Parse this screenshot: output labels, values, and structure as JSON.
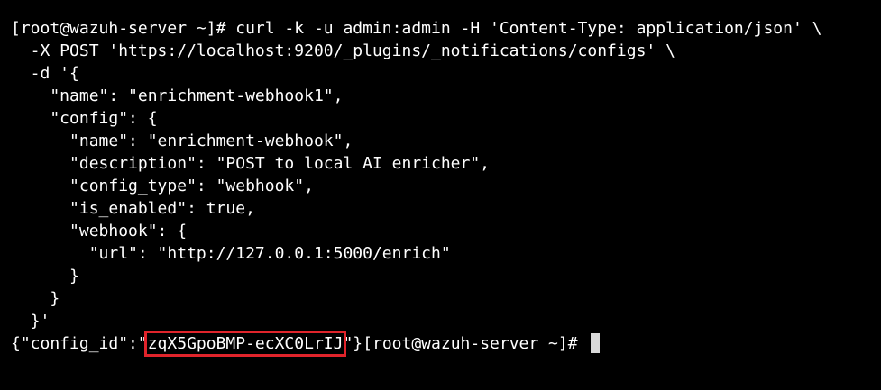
{
  "terminal": {
    "lines": [
      "[root@wazuh-server ~]# curl -k -u admin:admin -H 'Content-Type: application/json' \\",
      "  -X POST 'https://localhost:9200/_plugins/_notifications/configs' \\",
      "  -d '{",
      "    \"name\": \"enrichment-webhook1\",",
      "    \"config\": {",
      "      \"name\": \"enrichment-webhook\",",
      "      \"description\": \"POST to local AI enricher\",",
      "      \"config_type\": \"webhook\",",
      "      \"is_enabled\": true,",
      "      \"webhook\": {",
      "        \"url\": \"http://127.0.0.1:5000/enrich\"",
      "      }",
      "    }",
      "  }'"
    ],
    "output": {
      "prefix": "{\"config_id\":\"",
      "config_id": "zqX5GpoBMP-ecXC0LrIJ",
      "suffix": "\"}",
      "prompt": "[root@wazuh-server ~]# "
    },
    "highlight_color": "#e0242b",
    "background_color": "#000000",
    "text_color": "#ffffff"
  }
}
